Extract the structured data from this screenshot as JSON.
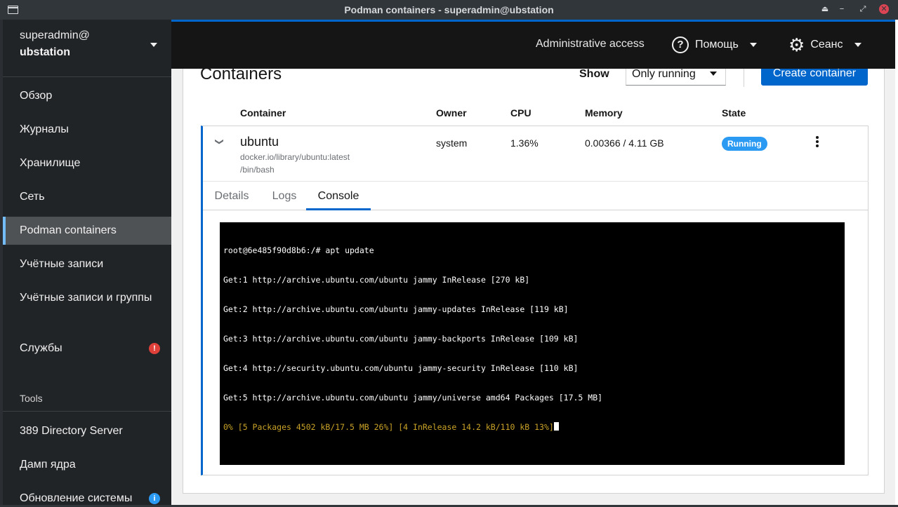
{
  "window": {
    "title": "Podman containers - superadmin@ubstation",
    "buttons": {
      "keep_above": "⏏",
      "minimize": "−",
      "maximize": "⤢",
      "close": "✕"
    }
  },
  "sidebar": {
    "host_user": "superadmin@",
    "host_name": "ubstation",
    "items": [
      {
        "label": "Обзор"
      },
      {
        "label": "Журналы"
      },
      {
        "label": "Хранилище"
      },
      {
        "label": "Сеть"
      },
      {
        "label": "Podman containers",
        "active": true
      },
      {
        "label": "Учётные записи"
      },
      {
        "label": "Учётные записи и группы"
      },
      {
        "label": "Службы",
        "badge": "!",
        "badge_color": "#e0403a"
      }
    ],
    "tools_title": "Tools",
    "tools": [
      {
        "label": "389 Directory Server"
      },
      {
        "label": "Дамп ядра"
      },
      {
        "label": "Обновление системы",
        "badge": "i",
        "badge_color": "#2b9af3"
      }
    ]
  },
  "header": {
    "admin_label": "Administrative access",
    "help_label": "Помощь",
    "session_label": "Сеанс"
  },
  "containers": {
    "title": "Containers",
    "show_label": "Show",
    "filter_value": "Only running",
    "create_label": "Create container",
    "columns": [
      "Container",
      "Owner",
      "CPU",
      "Memory",
      "State"
    ],
    "rows": [
      {
        "name": "ubuntu",
        "image": "docker.io/library/ubuntu:latest",
        "command": "/bin/bash",
        "owner": "system",
        "cpu": "1.36%",
        "memory": "0.00366 / 4.11 GB",
        "state": "Running"
      }
    ],
    "tabs": [
      "Details",
      "Logs",
      "Console"
    ],
    "active_tab": "Console"
  },
  "terminal": {
    "lines": [
      "root@6e485f90d8b6:/# apt update",
      "Get:1 http://archive.ubuntu.com/ubuntu jammy InRelease [270 kB]",
      "Get:2 http://archive.ubuntu.com/ubuntu jammy-updates InRelease [119 kB]",
      "Get:3 http://archive.ubuntu.com/ubuntu jammy-backports InRelease [109 kB]",
      "Get:4 http://security.ubuntu.com/ubuntu jammy-security InRelease [110 kB]",
      "Get:5 http://archive.ubuntu.com/ubuntu jammy/universe amd64 Packages [17.5 MB]"
    ],
    "progress_line": "0% [5 Packages 4502 kB/17.5 MB 26%] [4 InRelease 14.2 kB/110 kB 13%]",
    "colors": {
      "background": "#000000",
      "text": "#ffffff",
      "progress": "#c9a227"
    }
  },
  "colors": {
    "accent": "#0066cc",
    "running_badge": "#2b9af3",
    "sidebar_bg": "#212427",
    "header_bg": "#151515"
  }
}
